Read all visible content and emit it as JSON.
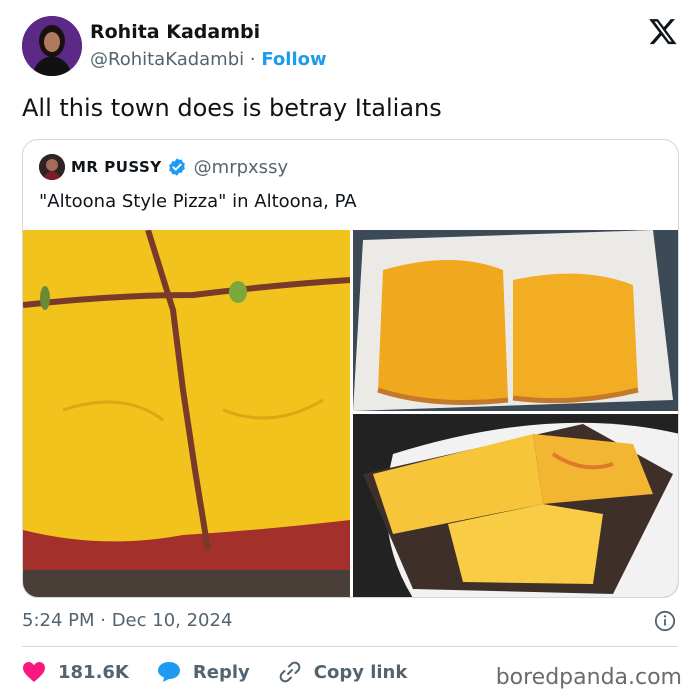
{
  "author": {
    "display_name": "Rohita Kadambi",
    "handle": "@RohitaKadambi",
    "separator": "·",
    "follow_label": "Follow"
  },
  "tweet": {
    "text": "All this town does is betray Italians",
    "timestamp": "5:24 PM · Dec 10, 2024"
  },
  "quoted": {
    "display_name": "MR PUSSY",
    "handle": "@mrpxssy",
    "text": "\"Altoona Style Pizza\" in Altoona, PA",
    "photos": [
      "pizza-closeup-photo",
      "pizza-in-paper-photo",
      "pizza-on-plate-photo"
    ]
  },
  "actions": {
    "likes": "181.6K",
    "reply_label": "Reply",
    "copy_link_label": "Copy link"
  },
  "watermark": "boredpanda.com",
  "colors": {
    "link": "#1d9bf0",
    "like": "#f91880",
    "secondary": "#536471",
    "border": "#cfd9de",
    "cheese": "#f3c21a"
  },
  "icons": [
    "x-logo-icon",
    "verified-badge-icon",
    "info-icon",
    "heart-icon",
    "reply-icon",
    "link-icon"
  ]
}
